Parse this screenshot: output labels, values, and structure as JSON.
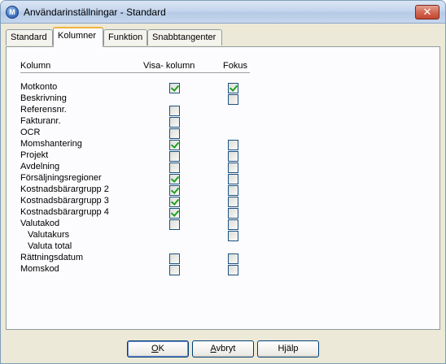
{
  "window": {
    "title": "Användarinställningar - Standard",
    "icon": "app-logo-icon",
    "close_symbol": "✕"
  },
  "tabs": [
    {
      "label": "Standard",
      "active": false
    },
    {
      "label": "Kolumner",
      "active": true
    },
    {
      "label": "Funktion",
      "active": false
    },
    {
      "label": "Snabbtangenter",
      "active": false
    }
  ],
  "columns": {
    "name": "Kolumn",
    "visible": "Visa- kolumn",
    "focus": "Fokus"
  },
  "rows": [
    {
      "label": "Motkonto",
      "indent": false,
      "visa": true,
      "fokus": true
    },
    {
      "label": "Beskrivning",
      "indent": false,
      "visa": null,
      "fokus": false
    },
    {
      "label": "Referensnr.",
      "indent": false,
      "visa": false,
      "fokus": null
    },
    {
      "label": "Fakturanr.",
      "indent": false,
      "visa": false,
      "fokus": null
    },
    {
      "label": "OCR",
      "indent": false,
      "visa": false,
      "fokus": null
    },
    {
      "label": "Momshantering",
      "indent": false,
      "visa": true,
      "fokus": false
    },
    {
      "label": "Projekt",
      "indent": false,
      "visa": false,
      "fokus": false
    },
    {
      "label": "Avdelning",
      "indent": false,
      "visa": false,
      "fokus": false
    },
    {
      "label": "Försäljningsregioner",
      "indent": false,
      "visa": true,
      "fokus": false
    },
    {
      "label": "Kostnadsbärargrupp 2",
      "indent": false,
      "visa": true,
      "fokus": false
    },
    {
      "label": "Kostnadsbärargrupp 3",
      "indent": false,
      "visa": true,
      "fokus": false
    },
    {
      "label": "Kostnadsbärargrupp 4",
      "indent": false,
      "visa": true,
      "fokus": false
    },
    {
      "label": "Valutakod",
      "indent": false,
      "visa": false,
      "fokus": false
    },
    {
      "label": "Valutakurs",
      "indent": true,
      "visa": null,
      "fokus": false
    },
    {
      "label": "Valuta total",
      "indent": true,
      "visa": null,
      "fokus": null
    },
    {
      "label": "Rättningsdatum",
      "indent": false,
      "visa": false,
      "fokus": false
    },
    {
      "label": "Momskod",
      "indent": false,
      "visa": false,
      "fokus": false
    }
  ],
  "buttons": {
    "ok": {
      "first": "O",
      "rest": "K"
    },
    "cancel": {
      "first": "A",
      "rest": "vbryt"
    },
    "help": {
      "pre": "H",
      "u": "j",
      "post": "älp"
    }
  }
}
